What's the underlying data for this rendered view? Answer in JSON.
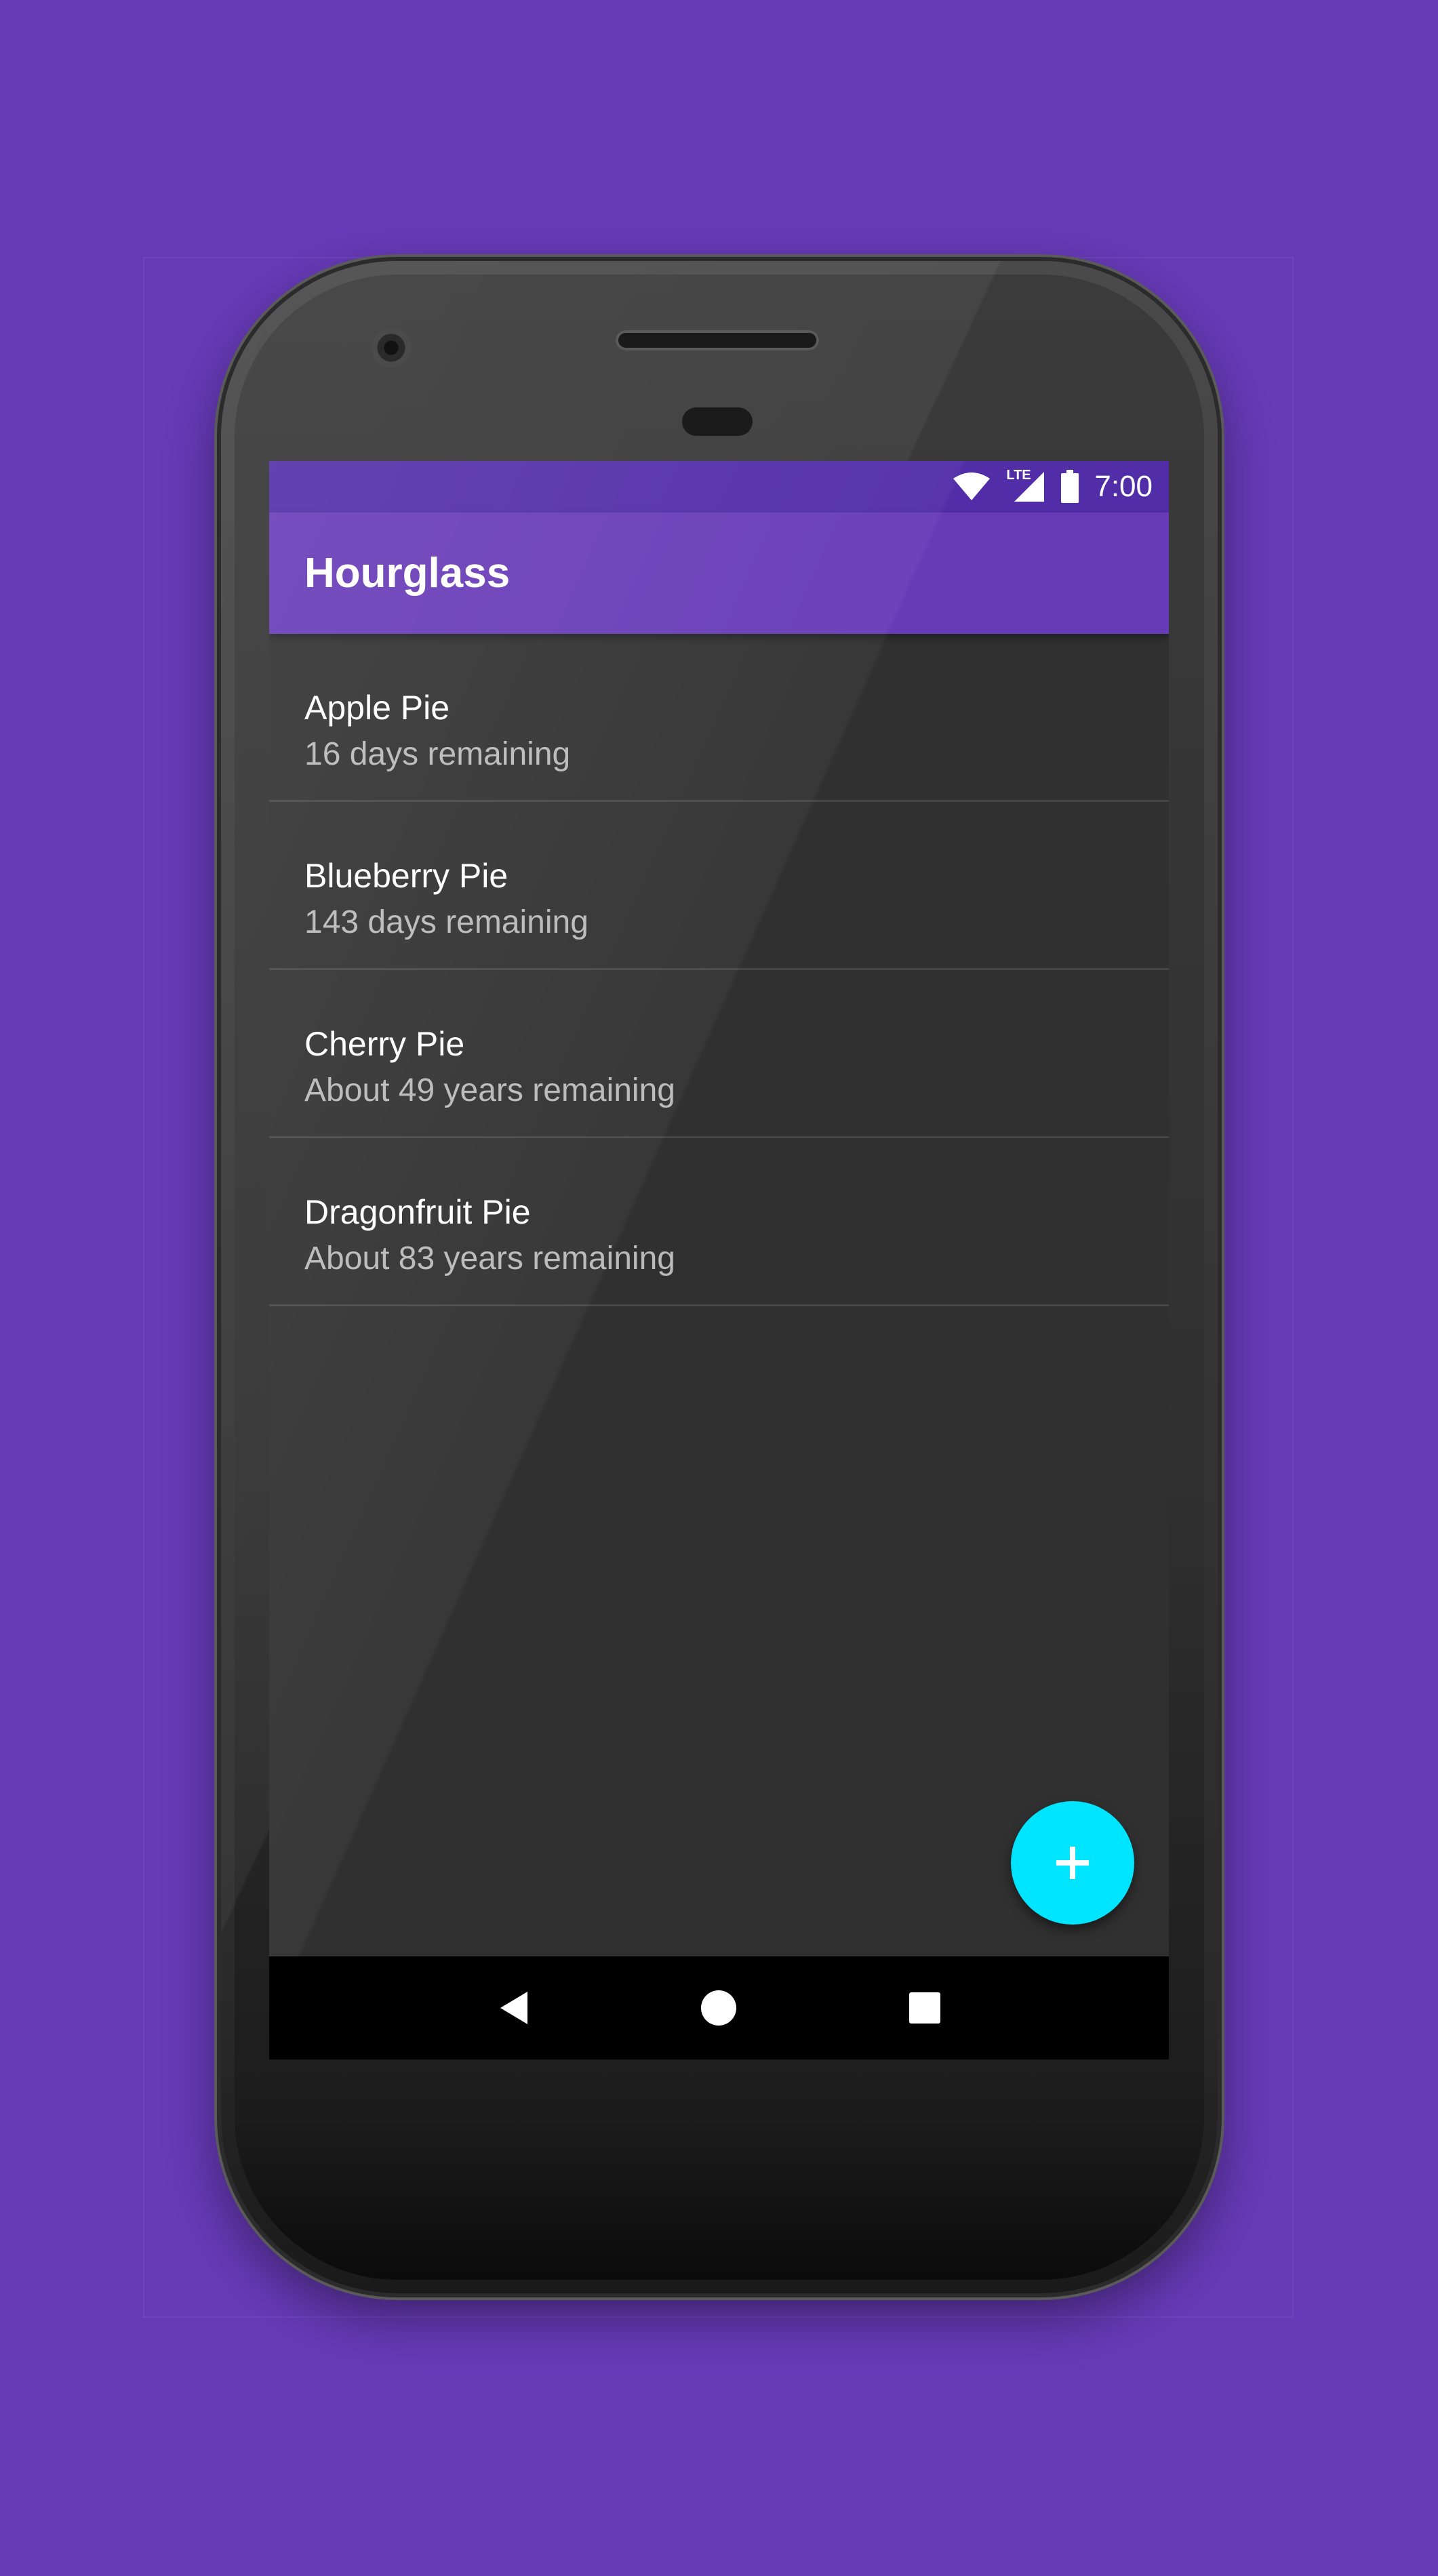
{
  "status_bar": {
    "network_label": "LTE",
    "time": "7:00",
    "icons": [
      "wifi-icon",
      "signal-icon",
      "battery-icon"
    ]
  },
  "app_bar": {
    "title": "Hourglass"
  },
  "items": [
    {
      "title": "Apple Pie",
      "subtitle": "16 days remaining"
    },
    {
      "title": "Blueberry Pie",
      "subtitle": "143 days remaining"
    },
    {
      "title": "Cherry Pie",
      "subtitle": "About 49 years remaining"
    },
    {
      "title": "Dragonfruit Pie",
      "subtitle": "About 83 years remaining"
    }
  ],
  "fab": {
    "icon": "plus-icon"
  },
  "nav_bar": {
    "icons": [
      "back-icon",
      "home-icon",
      "recents-icon"
    ]
  },
  "colors": {
    "background": "#673ab7",
    "status_bar": "#512da8",
    "app_bar": "#673ab7",
    "screen": "#303030",
    "fab": "#00e5ff",
    "subtitle_text": "#b9b9b9"
  }
}
